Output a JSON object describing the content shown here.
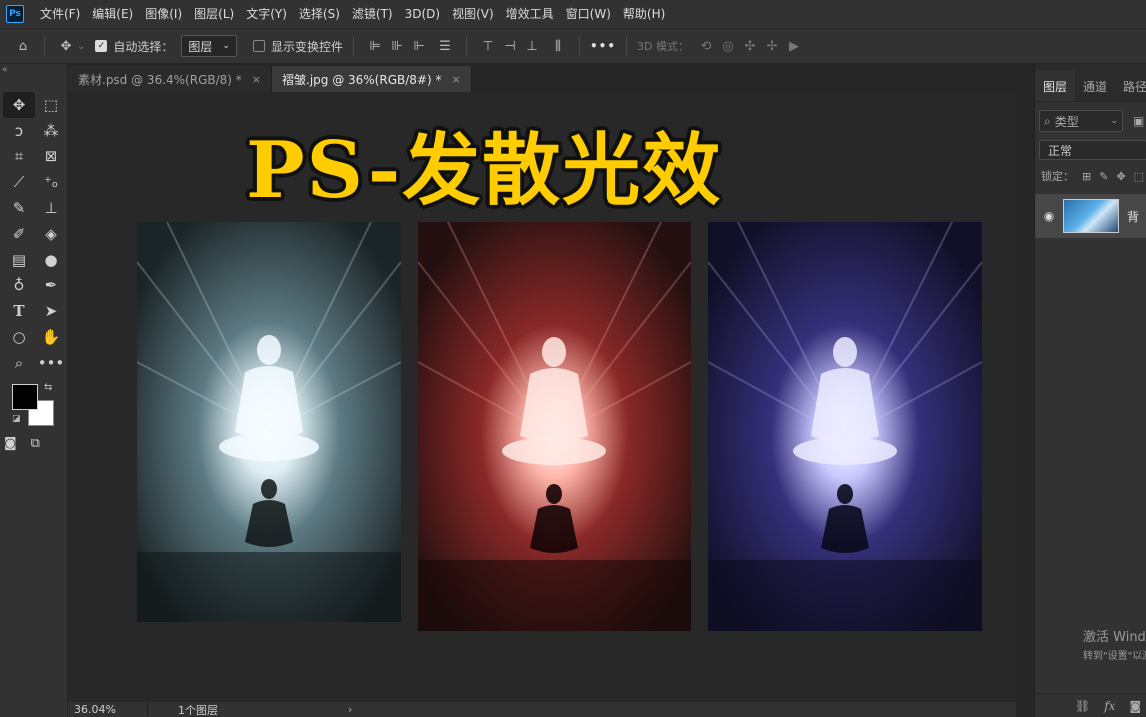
{
  "app": {
    "logo_text": "Ps"
  },
  "menu": [
    "文件(F)",
    "编辑(E)",
    "图像(I)",
    "图层(L)",
    "文字(Y)",
    "选择(S)",
    "滤镜(T)",
    "3D(D)",
    "视图(V)",
    "增效工具",
    "窗口(W)",
    "帮助(H)"
  ],
  "options": {
    "auto_select_label": "自动选择：",
    "auto_select_target": "图层",
    "show_transform_label": "显示变换控件",
    "mode_3d_label": "3D 模式：",
    "more": "•••"
  },
  "tabs": [
    {
      "label": "素材.psd @ 36.4%(RGB/8) *",
      "active": false
    },
    {
      "label": "褶皱.jpg @ 36%(RGB/8#) *",
      "active": true
    }
  ],
  "canvas": {
    "headline": "PS-发散光效",
    "artworks": [
      {
        "name": "buddha-glow-white",
        "glow_color": "#dfeff5",
        "tint": "#4a6168"
      },
      {
        "name": "buddha-glow-red",
        "glow_color": "#ffb4a8",
        "tint": "#8a2828"
      },
      {
        "name": "buddha-glow-blue",
        "glow_color": "#c8c8ff",
        "tint": "#35307a"
      }
    ]
  },
  "status": {
    "zoom": "36.04%",
    "info": "1个图层",
    "arrow": "›"
  },
  "panel": {
    "tabs": [
      "图层",
      "通道",
      "路径"
    ],
    "filter_label": "类型",
    "blend_mode": "正常",
    "lock_label": "锁定：",
    "layer_name": "背",
    "watermark_line1": "激活 Wind",
    "watermark_line2": "转到\"设置\"以激"
  },
  "colors": {
    "headline": "#ffcc00",
    "accent": "#31a8ff"
  }
}
